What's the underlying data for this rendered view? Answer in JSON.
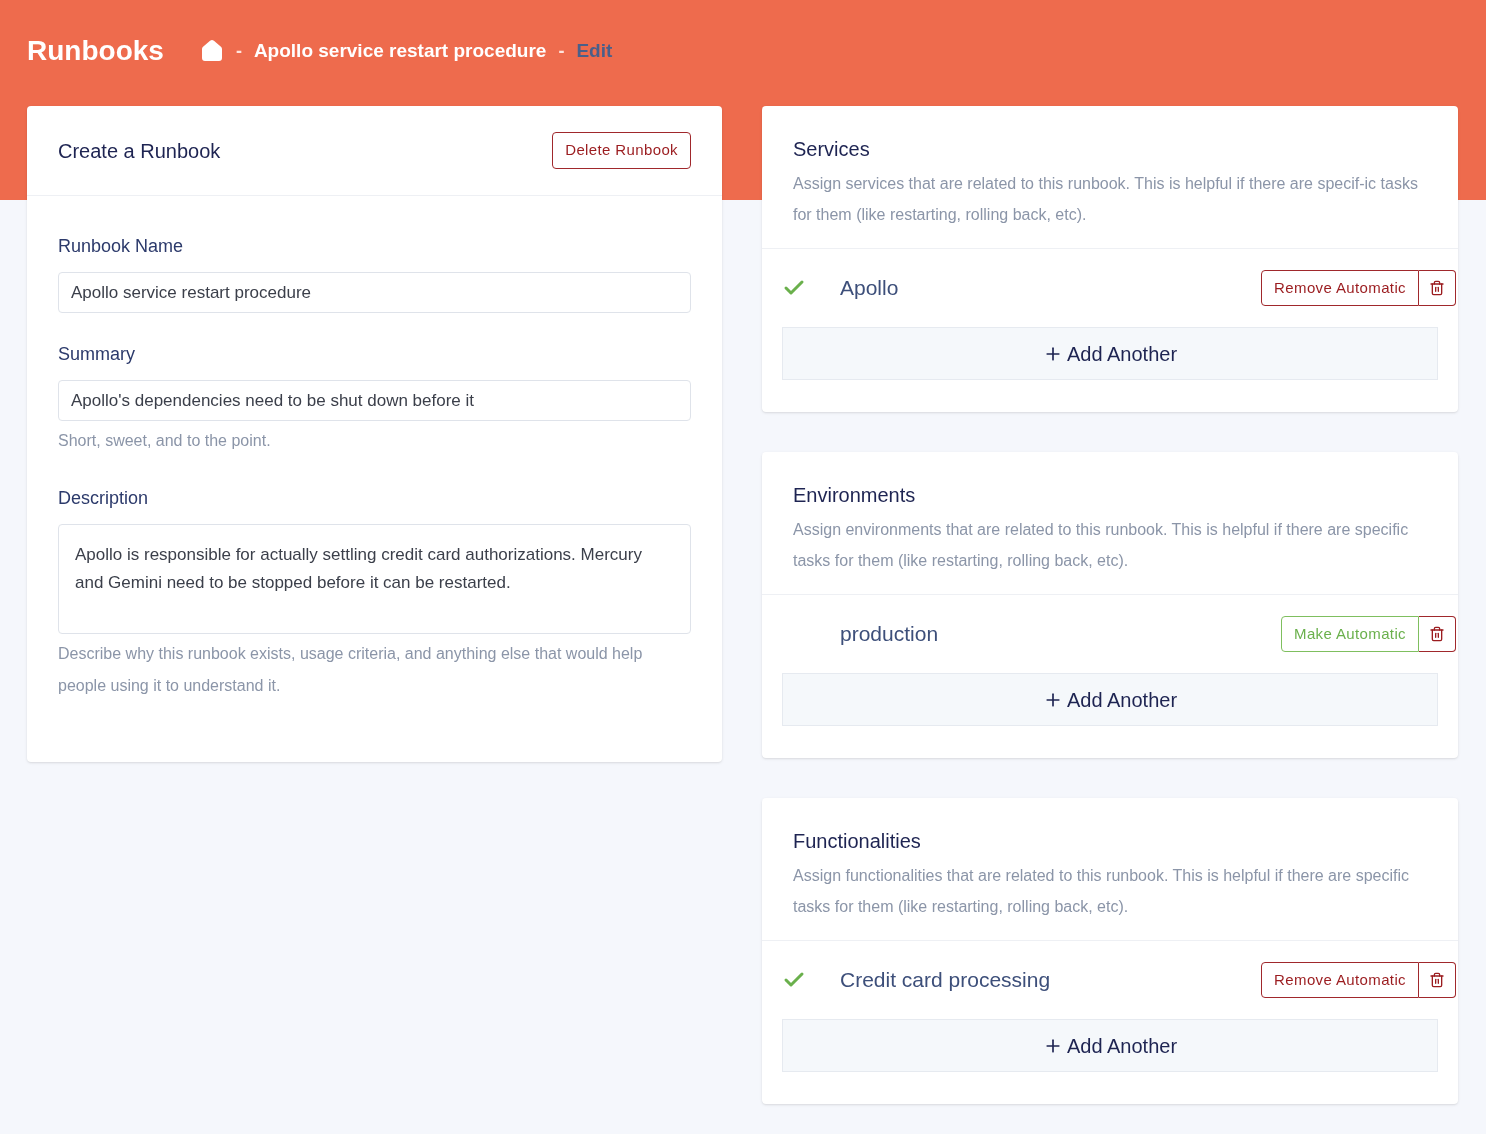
{
  "header": {
    "title": "Runbooks",
    "separator": "-",
    "breadcrumb": [
      {
        "kind": "home"
      },
      {
        "kind": "link",
        "label": "Apollo service restart procedure"
      },
      {
        "kind": "current",
        "label": "Edit"
      }
    ]
  },
  "form": {
    "title": "Create a Runbook",
    "delete_button": "Delete Runbook",
    "fields": [
      {
        "kind": "input",
        "label": "Runbook Name",
        "value": "Apollo service restart procedure"
      },
      {
        "kind": "input",
        "label": "Summary",
        "value": "Apollo's dependencies need to be shut down before it",
        "help": "Short, sweet, and to the point."
      },
      {
        "kind": "textarea",
        "label": "Description",
        "value": "Apollo is responsible for actually settling credit card authorizations. Mercury and Gemini need to be stopped before it can be restarted.",
        "help": "Describe why this runbook exists, usage criteria, and anything else that would help people using it to understand it."
      }
    ]
  },
  "sections": [
    {
      "title": "Services",
      "description": "Assign services that are related to this runbook. This is helpful if there are specif-ic tasks for them (like restarting, rolling back, etc).",
      "items": [
        {
          "name": "Apollo",
          "automatic": true,
          "action": "Remove Automatic"
        }
      ],
      "add_button": "Add Another"
    },
    {
      "title": "Environments",
      "description": "Assign environments that are related to this runbook. This is helpful if there are specific tasks for them (like restarting, rolling back, etc).",
      "items": [
        {
          "name": "production",
          "automatic": false,
          "action": "Make Automatic"
        }
      ],
      "add_button": "Add Another"
    },
    {
      "title": "Functionalities",
      "description": "Assign functionalities that are related to this runbook. This is helpful if there are specific tasks for them (like restarting, rolling back, etc).",
      "items": [
        {
          "name": "Credit card processing",
          "automatic": true,
          "action": "Remove Automatic"
        }
      ],
      "add_button": "Add Another"
    }
  ]
}
